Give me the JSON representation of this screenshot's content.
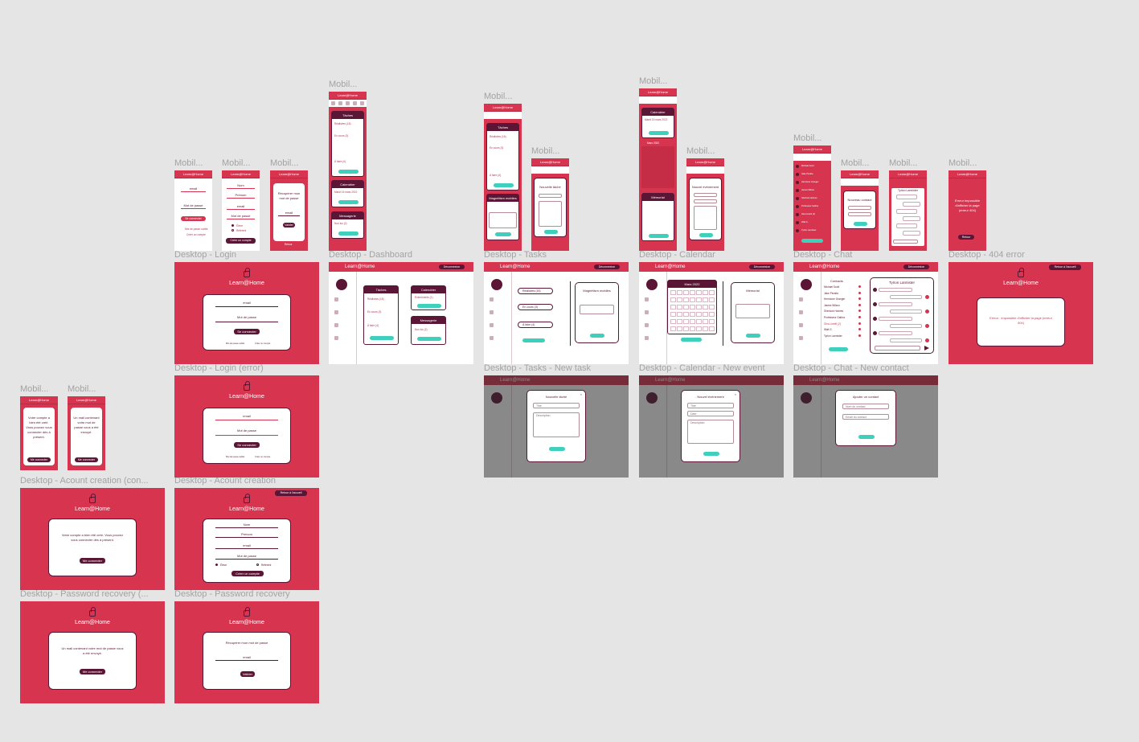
{
  "labels": {
    "m_login": "Mobil...",
    "m_creation": "Mobil...",
    "m_recovery": "Mobil...",
    "m_dashboard": "Mobil...",
    "m_tasks": "Mobil...",
    "m_newtask": "Mobil...",
    "m_calendar": "Mobil...",
    "m_newevent": "Mobil...",
    "m_chat": "Mobil...",
    "m_newcontact": "Mobil...",
    "m_conversation": "Mobil...",
    "m_404": "Mobil...",
    "m_created": "Mobil...",
    "m_recovered": "Mobil...",
    "d_login": "Desktop - Login",
    "d_dashboard": "Desktop - Dashboard",
    "d_tasks": "Desktop - Tasks",
    "d_calendar": "Desktop - Calendar",
    "d_chat": "Desktop - Chat",
    "d_404": "Desktop - 404 error",
    "d_login_error": "Desktop - Login (error)",
    "d_tasks_new": "Desktop - Tasks - New task",
    "d_calendar_new": "Desktop - Calendar - New event",
    "d_chat_new": "Desktop - Chat - New contact",
    "d_creation_conf": "Desktop - Acount creation (con...",
    "d_creation": "Desktop - Acount creation",
    "d_recovery_conf": "Desktop - Password recovery (...",
    "d_recovery": "Desktop - Password recovery"
  },
  "app": {
    "name": "Learn@Home",
    "logout": "Déconnexion",
    "back_home": "Retour à l'accueil"
  },
  "login": {
    "email": "email",
    "password": "Mot de passe",
    "connect": "Se connecter",
    "forgot": "Mot de passe oublié",
    "create": "Créer un compte"
  },
  "creation": {
    "nom": "Nom",
    "prenom": "Prénom",
    "email": "email",
    "password": "Mot de passe",
    "eleve": "Élève",
    "referent": "Référent",
    "create_btn": "Créer un compte",
    "confirm_text": "Votre compte a bien été créé. Vous pouvez vous connecter dès à présent.",
    "confirm_btn": "Me connecter"
  },
  "recovery": {
    "title": "Récupérer mon mot de passe",
    "email": "email",
    "validate": "Valider",
    "back": "Retour",
    "confirm_text": "Un mail contenant votre mot de passe vous a été envoyé.",
    "confirm_btn": "Me connecter"
  },
  "dashboard": {
    "tasks_title": "Tâches",
    "tasks_items": [
      "Réalisées (16)",
      "En cours (3)",
      "À faire (4)"
    ],
    "calendar_title": "Calendrier",
    "calendar_items": [
      "Événements (1)"
    ],
    "messages_title": "Messagerie",
    "messages_items": [
      "Non lus (2)"
    ],
    "calendar_date": "Mardi 15 mars 2022"
  },
  "tasks": {
    "filters": [
      "Réalisées (16)",
      "En cours (3)",
      "À faire (4)"
    ],
    "new_task": "Nouvelle tâche",
    "magnet": "Magnétism mobiles",
    "title_ph": "Titre",
    "desc_ph": "Description"
  },
  "calendar": {
    "month": "Mars 2022",
    "memo": "Mémorial",
    "new_event": "Nouvel événement",
    "title_ph": "Titre",
    "date_ph": "Date",
    "desc_ph": "Description"
  },
  "chat": {
    "contacts_title": "Contacts",
    "contacts": [
      "Michael Scott",
      "Jake Peralta",
      "Hermione Granger",
      "James Wilson",
      "Sherlock Holmes",
      "Professeur Galbra",
      "Gina Linetti (2)",
      "Walt G.",
      "Tyrion Lannister"
    ],
    "active": "Tyrion Lannister",
    "add_contact": "Ajouter un contact",
    "new_contact": "Nouveau contact",
    "name_ph": "Nom du contact",
    "email_ph": "Email du contact"
  },
  "error404": {
    "text": "Erreur : impossible d'afficher la page (erreur 404)",
    "mobile_text": "Erreur impossible d'afficher la page (erreur 404)",
    "back": "Retour"
  },
  "colors": {
    "brand": "#d6344f",
    "dark": "#5b1535",
    "accent": "#3fd0bd",
    "canvas": "#e5e5e5"
  }
}
